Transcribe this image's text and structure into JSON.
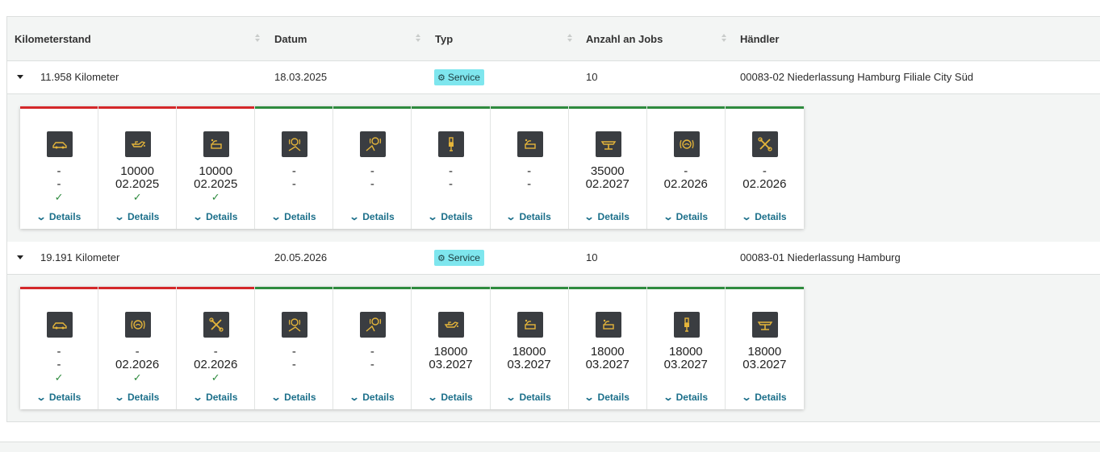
{
  "table": {
    "headers": {
      "kilometerstand": "Kilometerstand",
      "datum": "Datum",
      "typ": "Typ",
      "anzahl_jobs": "Anzahl an Jobs",
      "haendler": "Händler"
    },
    "rows": [
      {
        "kilometerstand": "11.958 Kilometer",
        "datum": "18.03.2025",
        "typ": "Service",
        "anzahl_jobs": "10",
        "haendler": "00083-02 Niederlassung Hamburg Filiale City Süd",
        "jobs": [
          {
            "icon": "car-icon",
            "status_color": "#d4282a",
            "v1": "-",
            "v2": "-",
            "check": "✓",
            "details": "Details"
          },
          {
            "icon": "oil-can-icon",
            "status_color": "#d4282a",
            "v1": "10000",
            "v2": "02.2025",
            "check": "✓",
            "details": "Details"
          },
          {
            "icon": "wiper-fluid-icon",
            "status_color": "#d4282a",
            "v1": "10000",
            "v2": "02.2025",
            "check": "✓",
            "details": "Details"
          },
          {
            "icon": "brake-front-icon",
            "status_color": "#2e8b3e",
            "v1": "-",
            "v2": "-",
            "check": "",
            "details": "Details"
          },
          {
            "icon": "brake-rear-icon",
            "status_color": "#2e8b3e",
            "v1": "-",
            "v2": "-",
            "check": "",
            "details": "Details"
          },
          {
            "icon": "spark-plug-icon",
            "status_color": "#2e8b3e",
            "v1": "-",
            "v2": "-",
            "check": "",
            "details": "Details"
          },
          {
            "icon": "wiper-fluid-icon",
            "status_color": "#2e8b3e",
            "v1": "-",
            "v2": "-",
            "check": "",
            "details": "Details"
          },
          {
            "icon": "lift-icon",
            "status_color": "#2e8b3e",
            "v1": "35000",
            "v2": "02.2027",
            "check": "",
            "details": "Details"
          },
          {
            "icon": "brake-fluid-icon",
            "status_color": "#2e8b3e",
            "v1": "-",
            "v2": "02.2026",
            "check": "",
            "details": "Details"
          },
          {
            "icon": "tools-icon",
            "status_color": "#2e8b3e",
            "v1": "-",
            "v2": "02.2026",
            "check": "",
            "details": "Details"
          }
        ]
      },
      {
        "kilometerstand": "19.191 Kilometer",
        "datum": "20.05.2026",
        "typ": "Service",
        "anzahl_jobs": "10",
        "haendler": "00083-01 Niederlassung Hamburg",
        "jobs": [
          {
            "icon": "car-icon",
            "status_color": "#d4282a",
            "v1": "-",
            "v2": "-",
            "check": "✓",
            "details": "Details"
          },
          {
            "icon": "brake-fluid-icon",
            "status_color": "#d4282a",
            "v1": "-",
            "v2": "02.2026",
            "check": "✓",
            "details": "Details"
          },
          {
            "icon": "tools-icon",
            "status_color": "#d4282a",
            "v1": "-",
            "v2": "02.2026",
            "check": "✓",
            "details": "Details"
          },
          {
            "icon": "brake-front-icon",
            "status_color": "#2e8b3e",
            "v1": "-",
            "v2": "-",
            "check": "",
            "details": "Details"
          },
          {
            "icon": "brake-rear-icon",
            "status_color": "#2e8b3e",
            "v1": "-",
            "v2": "-",
            "check": "",
            "details": "Details"
          },
          {
            "icon": "oil-can-icon",
            "status_color": "#2e8b3e",
            "v1": "18000",
            "v2": "03.2027",
            "check": "",
            "details": "Details"
          },
          {
            "icon": "wiper-fluid-icon",
            "status_color": "#2e8b3e",
            "v1": "18000",
            "v2": "03.2027",
            "check": "",
            "details": "Details"
          },
          {
            "icon": "wiper-fluid-icon",
            "status_color": "#2e8b3e",
            "v1": "18000",
            "v2": "03.2027",
            "check": "",
            "details": "Details"
          },
          {
            "icon": "spark-plug-icon",
            "status_color": "#2e8b3e",
            "v1": "18000",
            "v2": "03.2027",
            "check": "",
            "details": "Details"
          },
          {
            "icon": "lift-icon",
            "status_color": "#2e8b3e",
            "v1": "18000",
            "v2": "03.2027",
            "check": "",
            "details": "Details"
          }
        ]
      }
    ]
  },
  "colors": {
    "icon_fg": "#e5b53a",
    "badge_bg": "#7ee6ee",
    "link": "#1b6f8a",
    "overdue": "#d4282a",
    "ok": "#2e8b3e"
  }
}
